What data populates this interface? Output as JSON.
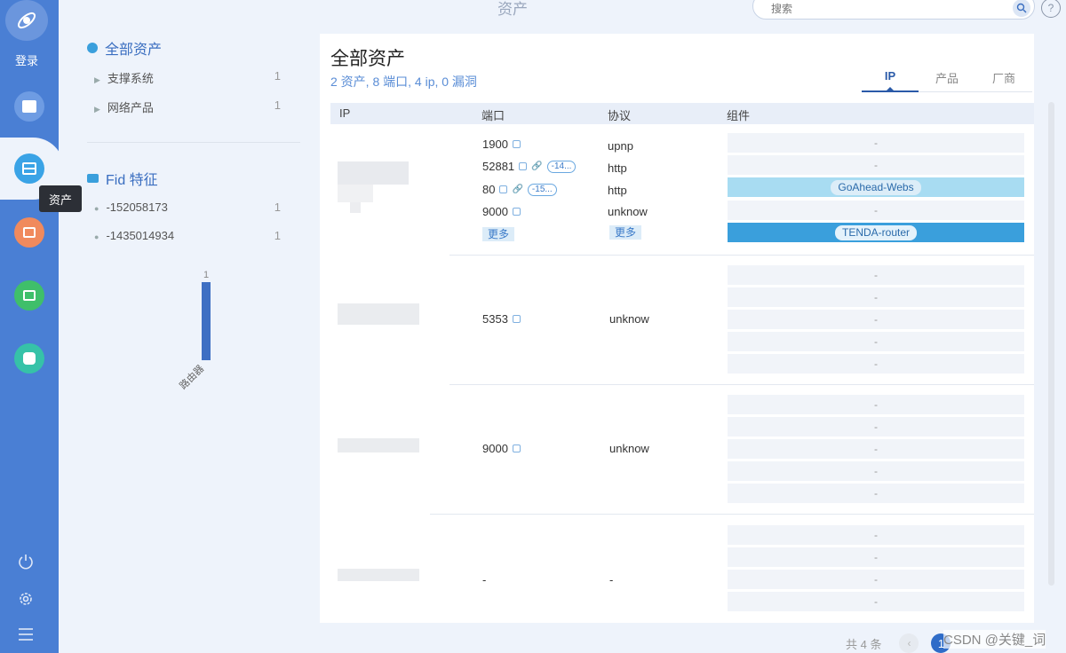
{
  "rail": {
    "login_label": "登录",
    "tooltip": "资产",
    "accent": "#4a7fd4"
  },
  "header": {
    "title": "资产",
    "search_placeholder": "搜索",
    "help": "?"
  },
  "filters": {
    "all_assets": {
      "title": "全部资产",
      "items": [
        {
          "label": "支撑系统",
          "count": "1"
        },
        {
          "label": "网络产品",
          "count": "1"
        }
      ]
    },
    "fid": {
      "title": "Fid 特征",
      "items": [
        {
          "label": "-152058173",
          "count": "1"
        },
        {
          "label": "-1435014934",
          "count": "1"
        }
      ]
    }
  },
  "chart_data": {
    "type": "bar",
    "categories": [
      "路由器"
    ],
    "values": [
      1
    ],
    "data_labels": [
      "1"
    ],
    "color": "#3e6fc3"
  },
  "main": {
    "title": "全部资产",
    "summary": "2 资产, 8 端口, 4 ip, 0 漏洞",
    "tabs": [
      "IP",
      "产品",
      "厂商"
    ],
    "active_tab": "IP",
    "columns": [
      "IP",
      "端口",
      "协议",
      "组件"
    ],
    "more_label": "更多",
    "rows": [
      {
        "ports": [
          {
            "port": "1900",
            "protocol": "upnp",
            "link": false,
            "pill": ""
          },
          {
            "port": "52881",
            "protocol": "http",
            "link": true,
            "pill": "-14..."
          },
          {
            "port": "80",
            "protocol": "http",
            "link": true,
            "pill": "-15..."
          },
          {
            "port": "9000",
            "protocol": "unknow",
            "link": false,
            "pill": ""
          }
        ],
        "components": [
          "-",
          "-",
          "GoAhead-Webs",
          "-",
          "TENDA-router"
        ]
      },
      {
        "ports": [
          {
            "port": "5353",
            "protocol": "unknow"
          }
        ],
        "components": [
          "-",
          "-",
          "-",
          "-",
          "-"
        ]
      },
      {
        "ports": [
          {
            "port": "9000",
            "protocol": "unknow"
          }
        ],
        "components": [
          "-",
          "-",
          "-",
          "-",
          "-"
        ]
      },
      {
        "ports": [
          {
            "port": "-",
            "protocol": "-"
          }
        ],
        "components": [
          "-",
          "-",
          "-",
          "-"
        ]
      }
    ]
  },
  "pagination": {
    "total": "共 4 条",
    "current": "1"
  },
  "watermark": "CSDN @关键_词"
}
